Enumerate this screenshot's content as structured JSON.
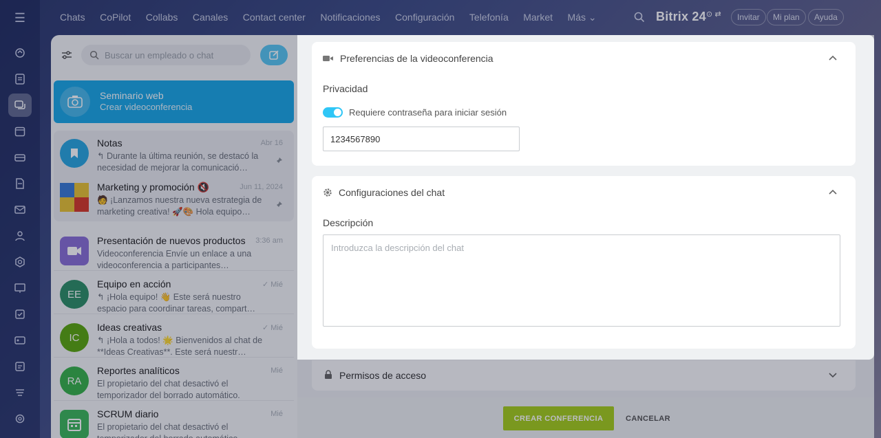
{
  "topnav": [
    "Chats",
    "CoPilot",
    "Collabs",
    "Canales",
    "Contact center",
    "Notificaciones",
    "Configuración",
    "Telefonía",
    "Market",
    "Más ⌄"
  ],
  "brand": {
    "name": "Bitrix",
    "version": "24"
  },
  "top_buttons": {
    "invite": "Invitar",
    "plan": "Mi plan",
    "help": "Ayuda"
  },
  "chatlist": {
    "search_placeholder": "Buscar un empleado o chat",
    "webinar": {
      "title": "Seminario web",
      "subtitle": "Crear videoconferencia"
    },
    "pinned": [
      {
        "title": "Notas",
        "time": "Abr 16",
        "message": "↰ Durante la última reunión, se destacó la necesidad de mejorar la comunicació…",
        "color": "#2aa7e0"
      },
      {
        "title": "Marketing y promoción 🔇",
        "time": "Jun 11, 2024",
        "message": "🧑 ¡Lanzamos nuestra nueva estrategia de marketing creativa! 🚀🎨 Hola equipo…",
        "color": "#d94a3a"
      }
    ],
    "items": [
      {
        "title": "Presentación de nuevos productos",
        "time": "3:36 am",
        "message": "Videoconferencia Envíe un enlace a una videoconferencia a participantes…",
        "initials": "",
        "color": "#8a6fd6"
      },
      {
        "title": "Equipo en acción",
        "time": "✓ Mié",
        "message": "↰ ¡Hola equipo! 👋 Este será nuestro espacio para coordinar tareas, compart…",
        "initials": "EE",
        "color": "#2e8f67"
      },
      {
        "title": "Ideas creativas",
        "time": "✓ Mié",
        "message": "↰ ¡Hola a todos! 🌟 Bienvenidos al chat de **Ideas Creativas**. Este será nuestr…",
        "initials": "IC",
        "color": "#5ba70f"
      },
      {
        "title": "Reportes analíticos",
        "time": "Mié",
        "message": "El propietario del chat desactivó el temporizador del borrado automático.",
        "initials": "RA",
        "color": "#38b24a"
      },
      {
        "title": "SCRUM diario",
        "time": "Mié",
        "message": "El propietario del chat desactivó el temporizador del borrado automático.",
        "initials": "",
        "color": "#3eb85a"
      }
    ]
  },
  "video_prefs": {
    "title": "Preferencias de la videoconferencia",
    "privacy_label": "Privacidad",
    "toggle_label": "Requiere contraseña para iniciar sesión",
    "toggle_on": true,
    "password": "1234567890"
  },
  "chat_config": {
    "title": "Configuraciones del chat",
    "description_label": "Descripción",
    "description_placeholder": "Introduzca la descripción del chat",
    "description_value": ""
  },
  "access": {
    "title": "Permisos de acceso"
  },
  "actions": {
    "create": "CREAR CONFERENCIA",
    "cancel": "CANCELAR"
  },
  "colors": {
    "accent": "#2fc6f6",
    "create_button": "#a6ce1c",
    "webinar": "#1ba8e6"
  }
}
